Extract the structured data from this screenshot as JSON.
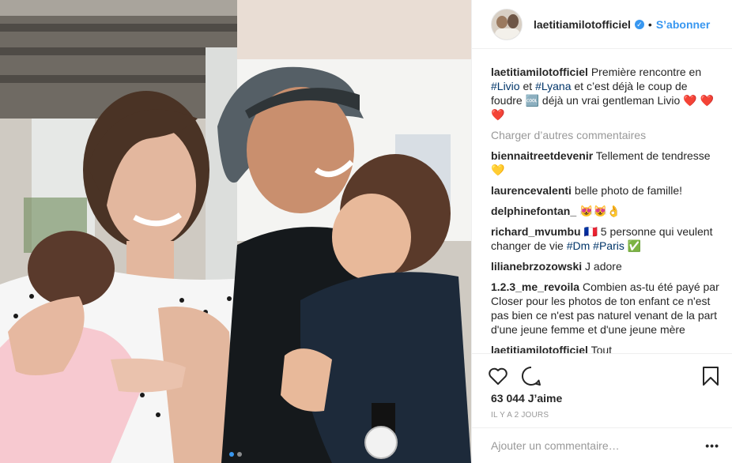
{
  "post": {
    "dots": 2,
    "active_dot": 0
  },
  "header": {
    "username": "laetitiamilotofficiel",
    "verified_icon": "verified-badge-icon",
    "separator": "•",
    "follow_label": "S’abonner"
  },
  "caption": {
    "username": "laetitiamilotofficiel",
    "text_1": "Première rencontre en ",
    "tag_1": "#Livio",
    "text_2": " et ",
    "tag_2": "#Lyana",
    "text_3": " et c’est déjà le coup de foudre 🆒 déjà un vrai gentleman Livio ❤️ ❤️❤️"
  },
  "load_more": "Charger d’autres commentaires",
  "comments": [
    {
      "user": "biennaitreetdevenir",
      "text": "Tellement de tendresse 💛"
    },
    {
      "user": "laurencevalenti",
      "text": "belle photo de famille!"
    },
    {
      "user": "delphinefontan_",
      "text": "😻😻👌"
    },
    {
      "user": "richard_mvumbu",
      "text": "🇫🇷 5 personne qui veulent changer de vie ",
      "tags": "#Dm #Paris",
      "suffix": " ✅"
    },
    {
      "user": "lilianebrzozowski",
      "text": "J adore"
    },
    {
      "user": "1.2.3_me_revoila",
      "text": "Combien as-tu été payé par Closer pour les photos de ton enfant ce n'est pas bien ce n'est pas naturel venant de la part d'une jeune femme et d'une jeune mère"
    },
    {
      "user": "laetitiamilotofficiel",
      "text": "Tout"
    }
  ],
  "actions": {
    "like_icon": "heart-icon",
    "comment_icon": "comment-icon",
    "save_icon": "bookmark-icon"
  },
  "likes": "63 044 J’aime",
  "time": "IL Y A 2 JOURS",
  "add_comment": {
    "placeholder": "Ajouter un commentaire…",
    "more_label": "•••"
  },
  "colors": {
    "link": "#3897f0",
    "hashtag": "#003569",
    "muted": "#999999",
    "border": "#efefef"
  }
}
